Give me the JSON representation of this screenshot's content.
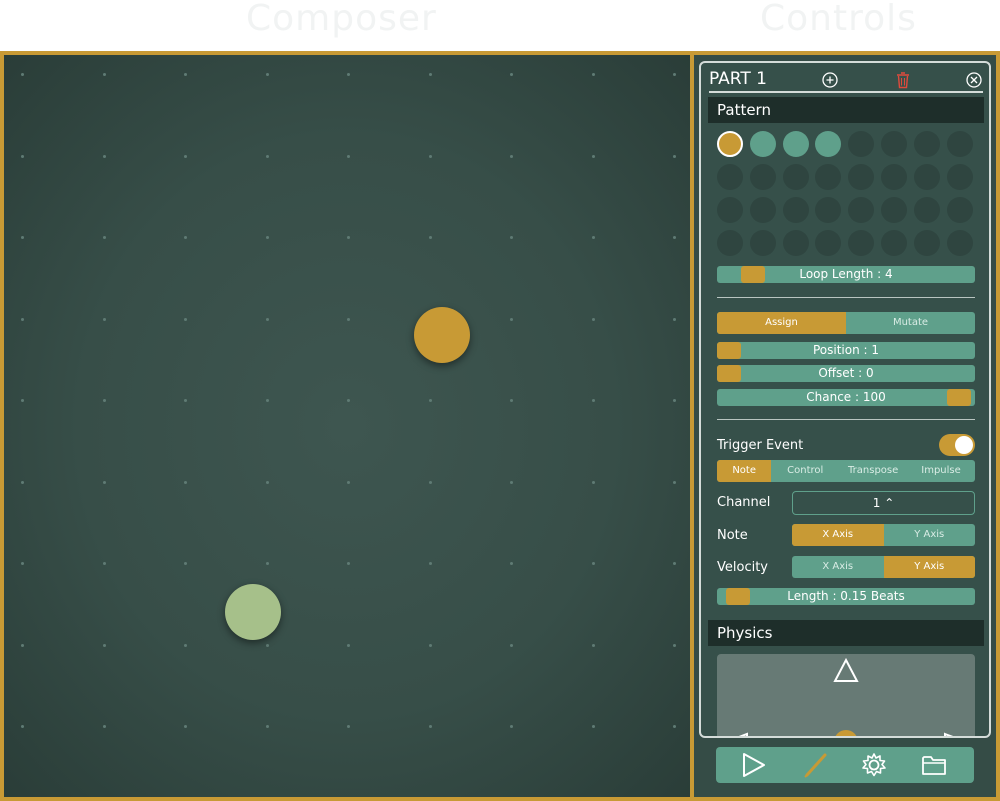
{
  "tabs": {
    "composer": "Composer",
    "controls": "Controls"
  },
  "part": {
    "title": "PART 1",
    "icons": [
      "add-icon",
      "trash-icon",
      "close-icon"
    ]
  },
  "pattern": {
    "header": "Pattern",
    "steps": 32,
    "active_steps": [
      1,
      2,
      3,
      4
    ],
    "current_step": 1,
    "loop_length_label": "Loop Length : 4",
    "loop_length_value": 4
  },
  "mode": {
    "options": [
      "Assign",
      "Mutate"
    ],
    "selected": "Assign"
  },
  "sliders": {
    "position": {
      "label": "Position : 1",
      "value": 1
    },
    "offset": {
      "label": "Offset : 0",
      "value": 0
    },
    "chance": {
      "label": "Chance : 100",
      "value": 100
    }
  },
  "trigger": {
    "label": "Trigger Event",
    "enabled": true,
    "event_types": [
      "Note",
      "Control",
      "Transpose",
      "Impulse"
    ],
    "selected_event": "Note"
  },
  "channel": {
    "label": "Channel",
    "value": "1"
  },
  "note": {
    "label": "Note",
    "options": [
      "X Axis",
      "Y Axis"
    ],
    "selected": "X Axis"
  },
  "velocity": {
    "label": "Velocity",
    "options": [
      "X Axis",
      "Y Axis"
    ],
    "selected": "Y Axis"
  },
  "length": {
    "label": "Length : 0.15 Beats",
    "value": 0.15
  },
  "physics": {
    "header": "Physics"
  },
  "toolbar": {
    "buttons": [
      "play-icon",
      "pencil-icon",
      "gear-icon",
      "folder-icon"
    ]
  },
  "colors": {
    "accent": "#c89a35",
    "teal": "#5fa08b",
    "canvas": "#3a524c",
    "ball_gold": "#c89a35",
    "ball_green": "#a6c08a"
  }
}
